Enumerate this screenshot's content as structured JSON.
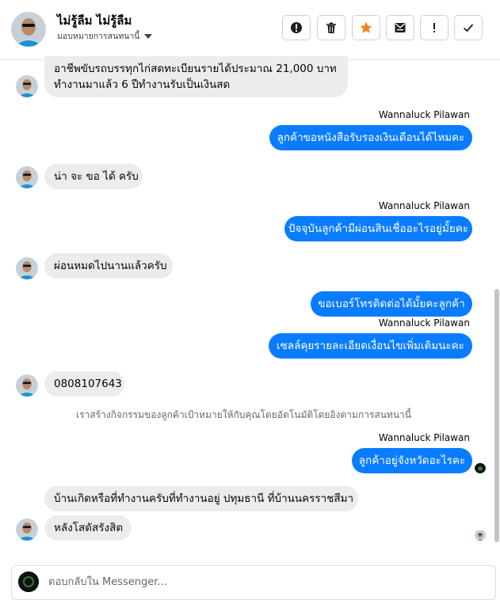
{
  "header": {
    "name": "ไม่รู้ลืม ไม่รู้ลืม",
    "assign_label": "มอบหมายการสนทนานี้",
    "actions": [
      {
        "name": "spam-report-button",
        "icon": "alert-circle-icon"
      },
      {
        "name": "delete-button",
        "icon": "trash-icon"
      },
      {
        "name": "star-button",
        "icon": "star-icon"
      },
      {
        "name": "mark-unread-button",
        "icon": "envelope-icon"
      },
      {
        "name": "follow-up-button",
        "icon": "exclamation-icon"
      },
      {
        "name": "done-button",
        "icon": "checkmark-icon"
      }
    ]
  },
  "messages": [
    {
      "dir": "in",
      "text": "อาชีพขับรถบรรทุกไก่สดทะเบียนรายได้ประมาณ 21,000 บาท\nทำงานมาแล้ว 6 ปีทำงานรับเป็นเงินสด"
    },
    {
      "dir": "out",
      "sender": "Wannaluck Pilawan",
      "text": "ลูกค้าขอหนังสือรับรองเงินเดือนได้ไหมคะ"
    },
    {
      "dir": "in",
      "text": "น่า จะ ขอ ได้ ครับ"
    },
    {
      "dir": "out",
      "sender": "Wannaluck Pilawan",
      "text": "ปัจจุบันลูกค้ามีผ่อนสินเชื่ออะไรอยู่มั้ยคะ"
    },
    {
      "dir": "in",
      "text": "ผ่อนหมดไปนานแล้วครับ"
    },
    {
      "dir": "out",
      "text": "ขอเบอร์โทรติดต่อได้มั้ยคะลูกค้า"
    },
    {
      "dir": "out",
      "sender": "Wannaluck Pilawan",
      "text": "เซลล์คุยรายละเอียดเงื่อนไขเพิ่มเติมนะคะ"
    },
    {
      "dir": "in",
      "text": "0808107643"
    },
    {
      "dir": "system",
      "text": "เราสร้างกิจกรรมของลูกค้าเป้าหมายให้กับคุณโดยอัตโนมัติโดยอิงตามการสนทนานี้"
    },
    {
      "dir": "out",
      "sender": "Wannaluck Pilawan",
      "text": "ลูกค้าอยู่จังหวัดอะไรคะ"
    },
    {
      "dir": "in",
      "text": "บ้านเกิดหรือที่ทำงานครับที่ทำงานอยู่ ปทุมธานี ที่บ้านนครราชสีมา"
    },
    {
      "dir": "in",
      "text": "หลังโสดัสรังสิต"
    }
  ],
  "composer": {
    "placeholder": "ตอบกลับใน Messenger..."
  },
  "colors": {
    "outgoing_bubble": "#0a7cff",
    "incoming_bubble": "#ececee",
    "star": "#f7821b"
  }
}
